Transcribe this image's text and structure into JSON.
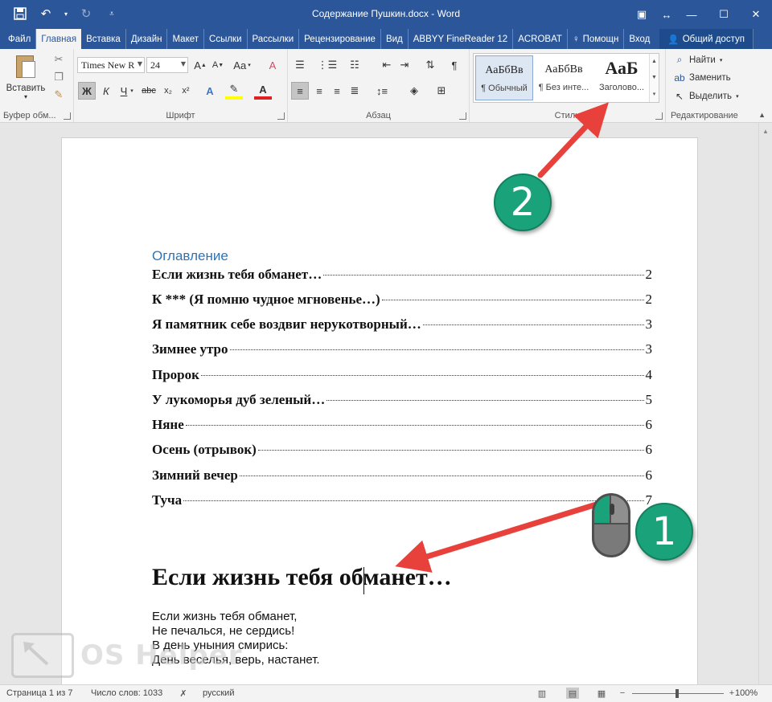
{
  "window": {
    "title": "Содержание Пушкин.docx - Word"
  },
  "tabs": [
    "Файл",
    "Главная",
    "Вставка",
    "Дизайн",
    "Макет",
    "Ссылки",
    "Рассылки",
    "Рецензирование",
    "Вид",
    "ABBYY FineReader 12",
    "ACROBAT",
    "Помощн",
    "Вход"
  ],
  "share_label": "Общий доступ",
  "ribbon": {
    "clipboard": {
      "paste_label": "Вставить",
      "group_label": "Буфер обм..."
    },
    "font": {
      "name": "Times New R",
      "size": "24",
      "aa_label": "Aa",
      "bold": "Ж",
      "italic": "К",
      "underline": "Ч",
      "strike": "abc",
      "sub": "x₂",
      "sup": "x²",
      "group_label": "Шрифт"
    },
    "paragraph": {
      "group_label": "Абзац"
    },
    "styles": {
      "items": [
        {
          "sample": "АаБбВв",
          "name": "¶ Обычный"
        },
        {
          "sample": "АаБбВв",
          "name": "¶ Без инте..."
        },
        {
          "sample": "АаБ",
          "name": "Заголово..."
        }
      ],
      "group_label": "Стили"
    },
    "editing": {
      "find": "Найти",
      "replace": "Заменить",
      "select": "Выделить",
      "group_label": "Редактирование"
    }
  },
  "toc": {
    "heading": "Оглавление",
    "entries": [
      {
        "title": "Если жизнь тебя обманет…",
        "page": "2"
      },
      {
        "title": "К *** (Я помню чудное мгновенье…)",
        "page": "2"
      },
      {
        "title": "Я памятник себе воздвиг нерукотворный…",
        "page": "3"
      },
      {
        "title": "Зимнее утро",
        "page": "3"
      },
      {
        "title": "Пророк",
        "page": "4"
      },
      {
        "title": "У лукоморья дуб зеленый…",
        "page": "5"
      },
      {
        "title": "Няне",
        "page": "6"
      },
      {
        "title": "Осень (отрывок)",
        "page": "6"
      },
      {
        "title": "Зимний вечер",
        "page": "6"
      },
      {
        "title": "Туча",
        "page": "7"
      }
    ]
  },
  "document": {
    "heading": "Если жизнь тебя обманет…",
    "poem_lines": [
      "Если жизнь тебя обманет,",
      "Не печалься, не сердись!",
      "В день уныния смирись:",
      "День веселья, верь, настанет."
    ]
  },
  "annotations": {
    "callout_1": "1",
    "callout_2": "2",
    "accent_color": "#1aa37a",
    "arrow_color": "#e8413c"
  },
  "watermark": {
    "text": "OS Helper"
  },
  "statusbar": {
    "page": "Страница 1 из 7",
    "words": "Число слов: 1033",
    "language": "русский",
    "zoom": "100%",
    "zoom_level_percent": 100
  }
}
